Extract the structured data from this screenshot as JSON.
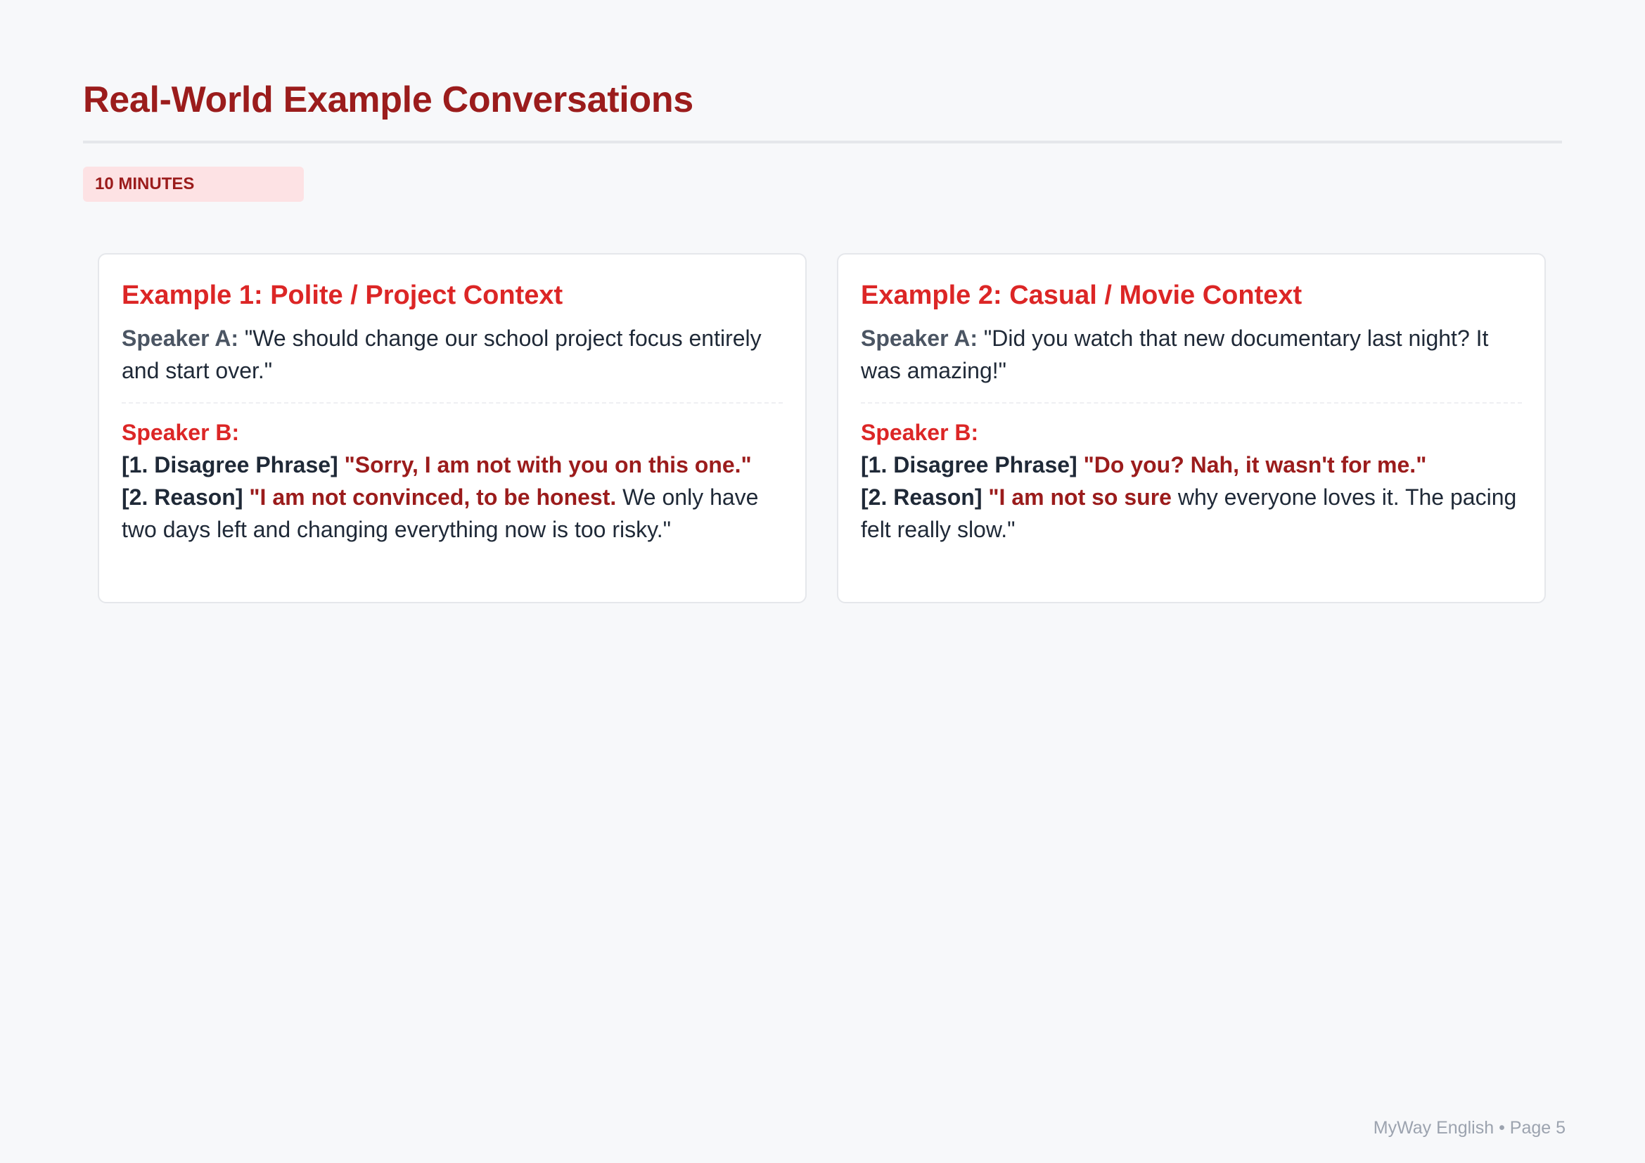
{
  "page": {
    "title": "Real-World Example Conversations",
    "badge": "10 MINUTES",
    "footer": "MyWay English • Page 5"
  },
  "examples": [
    {
      "title": "Example 1: Polite / Project Context",
      "speaker_a_label": "Speaker A:",
      "speaker_a_text": " \"We should change our school project focus entirely and start over.\"",
      "speaker_b_label": "Speaker B:",
      "line1_tag": "[1. Disagree Phrase]",
      "line1_highlight": " \"Sorry, I am not with you on this one.\"",
      "line2_tag": "[2. Reason]",
      "line2_highlight": " \"I am not convinced, to be honest.",
      "line2_rest": " We only have two days left and changing everything now is too risky.\""
    },
    {
      "title": "Example 2: Casual / Movie Context",
      "speaker_a_label": "Speaker A:",
      "speaker_a_text": " \"Did you watch that new documentary last night? It was amazing!\"",
      "speaker_b_label": "Speaker B:",
      "line1_tag": "[1. Disagree Phrase]",
      "line1_highlight": " \"Do you? Nah, it wasn't for me.\"",
      "line2_tag": "[2. Reason]",
      "line2_highlight": " \"I am not so sure",
      "line2_rest": " why everyone loves it. The pacing felt really slow.\""
    }
  ]
}
